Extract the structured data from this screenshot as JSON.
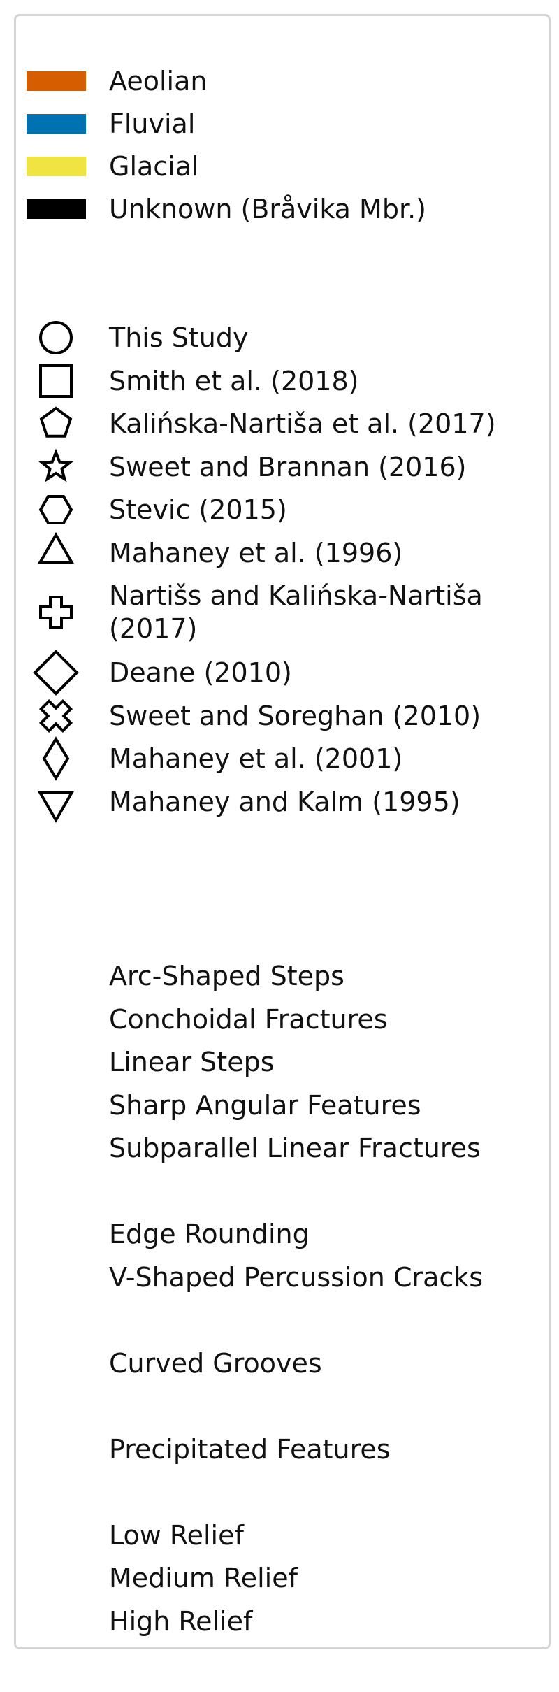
{
  "chart_data": {
    "type": "legend",
    "environments": [
      {
        "label": "Aeolian",
        "color": "#d55e00"
      },
      {
        "label": "Fluvial",
        "color": "#0072b2"
      },
      {
        "label": "Glacial",
        "color": "#f0e442"
      },
      {
        "label": "Unknown (Bråvika Mbr.)",
        "color": "#000000"
      }
    ],
    "studies": [
      {
        "label": "This Study",
        "marker": "circle"
      },
      {
        "label": "Smith et al. (2018)",
        "marker": "square"
      },
      {
        "label": "Kalińska-Nartiša et al. (2017)",
        "marker": "pentagon"
      },
      {
        "label": "Sweet and Brannan (2016)",
        "marker": "star"
      },
      {
        "label": "Stevic (2015)",
        "marker": "hexagon"
      },
      {
        "label": "Mahaney et al. (1996)",
        "marker": "triangle-up"
      },
      {
        "label": "Nartišs and Kalińska-Nartiša (2017)",
        "marker": "plus"
      },
      {
        "label": "Deane (2010)",
        "marker": "diamond"
      },
      {
        "label": "Sweet and Soreghan (2010)",
        "marker": "x"
      },
      {
        "label": "Mahaney et al. (2001)",
        "marker": "thin-diamond"
      },
      {
        "label": "Mahaney and Kalm (1995)",
        "marker": "triangle-down"
      }
    ],
    "feature_groups": [
      [
        "Arc-Shaped Steps",
        "Conchoidal Fractures",
        "Linear Steps",
        "Sharp Angular Features",
        "Subparallel Linear Fractures"
      ],
      [
        "Edge Rounding",
        "V-Shaped Percussion Cracks"
      ],
      [
        "Curved Grooves"
      ],
      [
        "Precipitated Features"
      ],
      [
        "Low Relief",
        "Medium Relief",
        "High Relief"
      ]
    ]
  }
}
